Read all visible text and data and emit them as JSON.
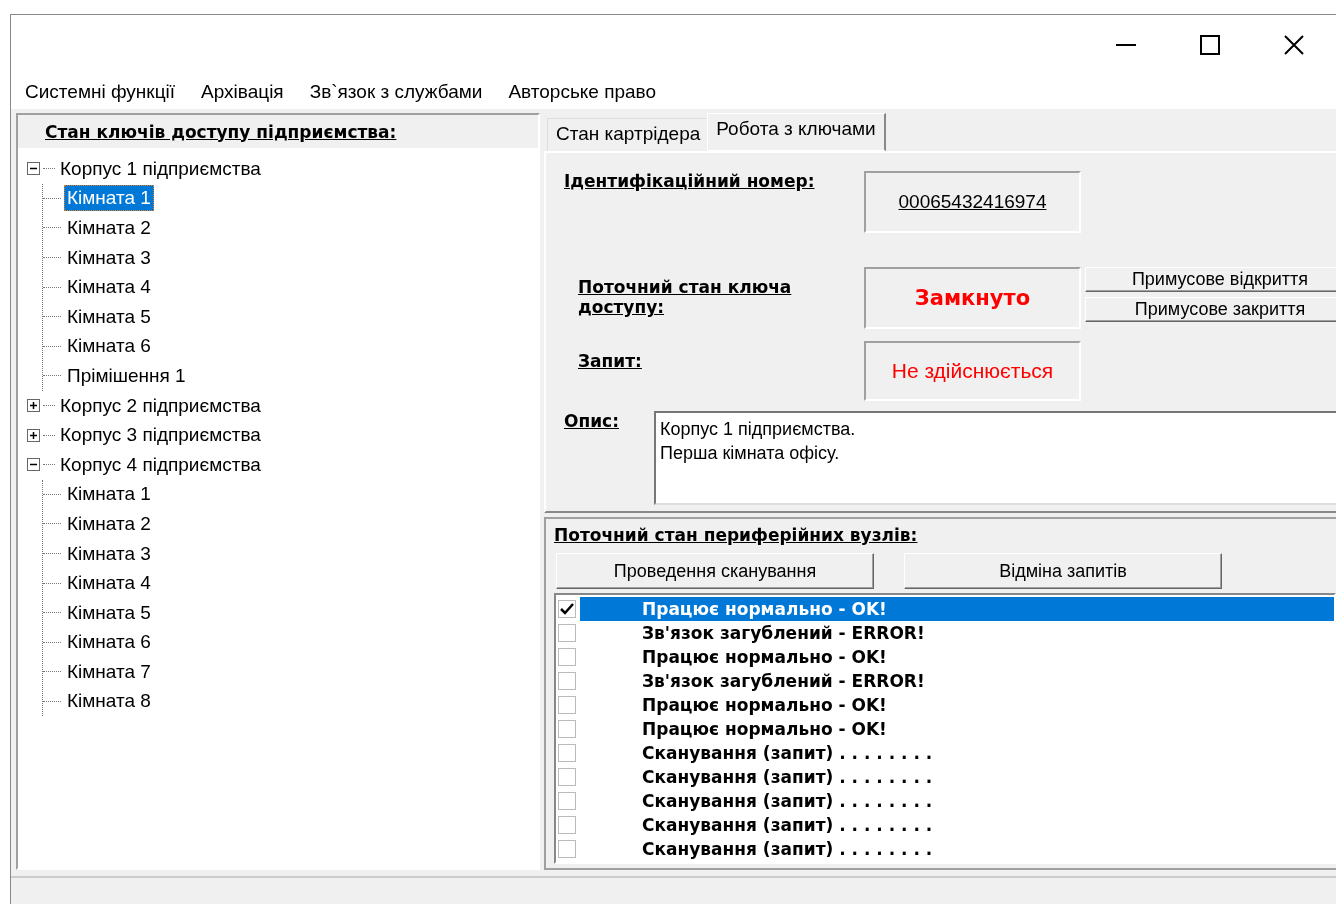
{
  "menu": [
    {
      "label": "Системні функції"
    },
    {
      "label": "Архівація"
    },
    {
      "label": "Зв`язок з службами"
    },
    {
      "label": "Авторське право"
    }
  ],
  "tree_panel": {
    "title": "Стан ключів доступу підприємства:",
    "nodes": [
      {
        "label": "Корпус 1 підприємства",
        "expanded": true,
        "selected": false,
        "children": [
          {
            "label": "Кімната 1",
            "selected": true
          },
          {
            "label": "Кімната 2",
            "selected": false
          },
          {
            "label": "Кімната 3",
            "selected": false
          },
          {
            "label": "Кімната 4",
            "selected": false
          },
          {
            "label": "Кімната 5",
            "selected": false
          },
          {
            "label": "Кімната 6",
            "selected": false
          },
          {
            "label": "Прімішення 1",
            "selected": false
          }
        ]
      },
      {
        "label": "Корпус 2 підприємства",
        "expanded": false,
        "selected": false
      },
      {
        "label": "Корпус 3 підприємства",
        "expanded": false,
        "selected": false
      },
      {
        "label": "Корпус 4 підприємства",
        "expanded": true,
        "selected": false,
        "children": [
          {
            "label": "Кімната 1",
            "selected": false
          },
          {
            "label": "Кімната 2",
            "selected": false
          },
          {
            "label": "Кімната 3",
            "selected": false
          },
          {
            "label": "Кімната 4",
            "selected": false
          },
          {
            "label": "Кімната 5",
            "selected": false
          },
          {
            "label": "Кімната 6",
            "selected": false
          },
          {
            "label": "Кімната 7",
            "selected": false
          },
          {
            "label": "Кімната 8",
            "selected": false
          }
        ]
      }
    ]
  },
  "tabs": [
    {
      "label": "Стан картрідера",
      "selected": false
    },
    {
      "label": "Робота з ключами",
      "selected": true
    }
  ],
  "key_panel": {
    "id_label": "Ідентифікаційний номер:",
    "id_value": "00065432416974",
    "state_label": "Поточний стан ключа доступу:",
    "state_value": "Замкнуто",
    "state_buttons": [
      "Примусове відкриття",
      "Примусове закриття"
    ],
    "request_label": "Запит:",
    "request_value": "Не здійснюється",
    "description_label": "Опис:",
    "description": "Корпус 1 підприємства.\nПерша кімната офісу."
  },
  "peripherals": {
    "title": "Поточний стан периферійних вузлів:",
    "buttons": [
      "Проведення сканування",
      "Відміна запитів"
    ],
    "items": [
      {
        "text": "Працює нормально - OK!",
        "checked": true,
        "selected": true
      },
      {
        "text": "Зв'язок загублений - ERROR!",
        "checked": false,
        "selected": false
      },
      {
        "text": "Працює нормально - OK!",
        "checked": false,
        "selected": false
      },
      {
        "text": "Зв'язок загублений - ERROR!",
        "checked": false,
        "selected": false
      },
      {
        "text": "Працює нормально - OK!",
        "checked": false,
        "selected": false
      },
      {
        "text": "Працює нормально - OK!",
        "checked": false,
        "selected": false
      },
      {
        "text": "Сканування (запит) . . . . . . . .",
        "checked": false,
        "selected": false
      },
      {
        "text": "Сканування (запит) . . . . . . . .",
        "checked": false,
        "selected": false
      },
      {
        "text": "Сканування (запит) . . . . . . . .",
        "checked": false,
        "selected": false
      },
      {
        "text": "Сканування (запит) . . . . . . . .",
        "checked": false,
        "selected": false
      },
      {
        "text": "Сканування (запит) . . . . . . . .",
        "checked": false,
        "selected": false
      }
    ]
  }
}
